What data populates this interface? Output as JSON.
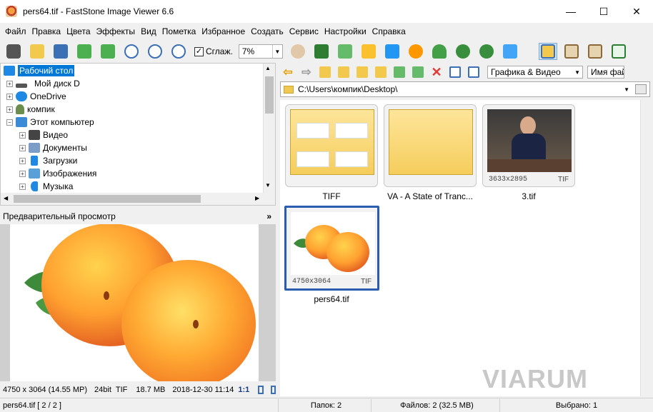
{
  "window": {
    "title": "pers64.tif  -  FastStone Image Viewer 6.6",
    "minimize": "—",
    "maximize": "☐",
    "close": "✕"
  },
  "menu": [
    "Файл",
    "Правка",
    "Цвета",
    "Эффекты",
    "Вид",
    "Пометка",
    "Избранное",
    "Создать",
    "Сервис",
    "Настройки",
    "Справка"
  ],
  "toolbar": {
    "smooth_label": "Сглаж.",
    "smooth_checked": "✓",
    "zoom_value": "7%",
    "icons": [
      "camera-icon",
      "open-folder-icon",
      "save-icon",
      "prev-icon",
      "next-icon",
      "zoom-in-icon",
      "zoom-out-icon",
      "actual-size-icon"
    ],
    "icons2": [
      "hand-icon",
      "filmstrip-icon",
      "export-icon",
      "resize-icon",
      "cb-icon",
      "brightness-icon",
      "stamp-icon",
      "rotate-left-icon",
      "rotate-right-icon",
      "checklist-icon"
    ],
    "layouts": [
      "layout-1-icon",
      "layout-2-icon",
      "layout-3-icon",
      "fullscreen-icon"
    ]
  },
  "tree": {
    "items": [
      {
        "label": "Рабочий стол",
        "level": 0,
        "icon": "desktop-icon",
        "color": "#1e88e5"
      },
      {
        "label": "Мой диск D",
        "level": 1,
        "icon": "drive-icon",
        "color": "#555555"
      },
      {
        "label": "OneDrive",
        "level": 1,
        "icon": "cloud-icon",
        "color": "#1e88e5"
      },
      {
        "label": "компик",
        "level": 1,
        "icon": "user-icon",
        "color": "#6b8e4e"
      },
      {
        "label": "Этот компьютер",
        "level": 1,
        "icon": "computer-icon",
        "color": "#3a8ad6"
      },
      {
        "label": "Видео",
        "level": 2,
        "icon": "film-icon",
        "color": "#444444"
      },
      {
        "label": "Документы",
        "level": 2,
        "icon": "documents-icon",
        "color": "#7a9cc6"
      },
      {
        "label": "Загрузки",
        "level": 2,
        "icon": "download-icon",
        "color": "#1e88e5"
      },
      {
        "label": "Изображения",
        "level": 2,
        "icon": "images-icon",
        "color": "#5aa0d8"
      },
      {
        "label": "Музыка",
        "level": 2,
        "icon": "music-icon",
        "color": "#1e88e5"
      }
    ]
  },
  "preview": {
    "header": "Предварительный просмотр",
    "collapse": "»"
  },
  "image_info": {
    "dims": "4750 x 3064 (14.55 MP)",
    "bits": "24bit",
    "format": "TIF",
    "size": "18.7 MB",
    "date": "2018-12-30 11:14",
    "ratio": "1:1"
  },
  "browser": {
    "filter": "Графика & Видео",
    "sort": "Имя фай",
    "path": "C:\\Users\\компик\\Desktop\\"
  },
  "thumbs": [
    {
      "label": "TIFF",
      "dims": "",
      "fmt": "",
      "type": "folder-tiff"
    },
    {
      "label": "VA - A State of Tranc...",
      "dims": "",
      "fmt": "",
      "type": "folder"
    },
    {
      "label": "3.tif",
      "dims": "3633x2895",
      "fmt": "TIF",
      "type": "person"
    },
    {
      "label": "pers64.tif",
      "dims": "4750x3064",
      "fmt": "TIF",
      "type": "peach"
    }
  ],
  "statusbar": {
    "file": "pers64.tif [ 2 / 2 ]",
    "folders": "Папок: 2",
    "files": "Файлов: 2 (32.5 MB)",
    "selected": "Выбрано: 1"
  },
  "watermark": "VIARUM"
}
